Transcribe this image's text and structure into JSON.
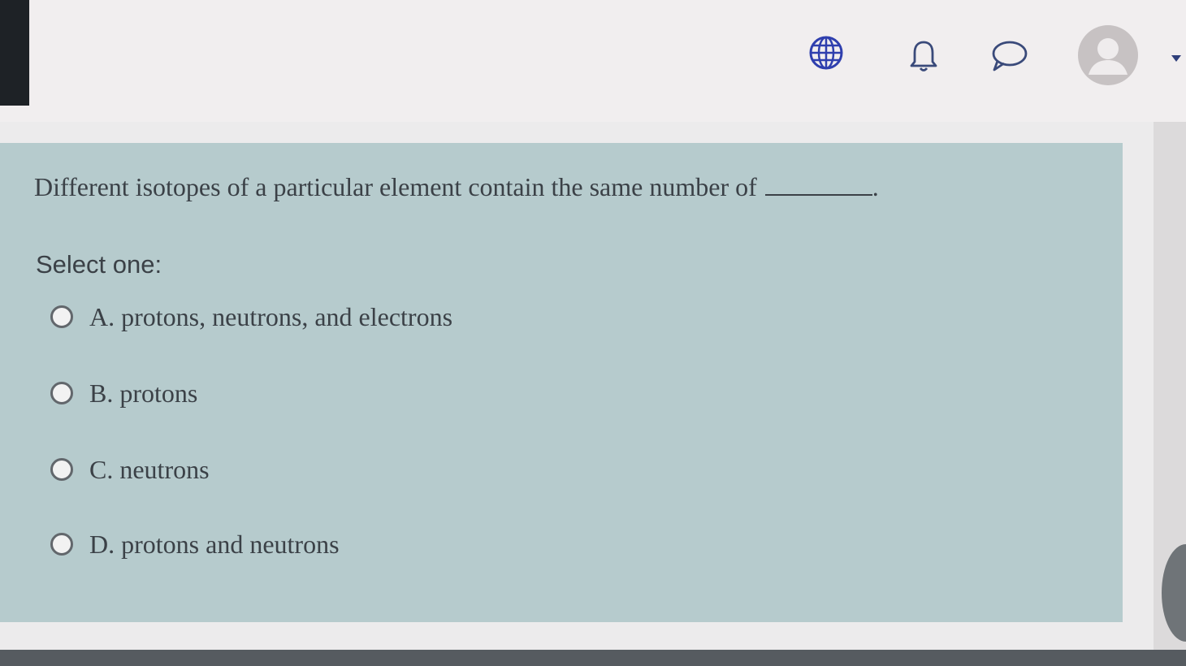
{
  "nav": {
    "icons": [
      "globe-icon",
      "bell-icon",
      "chat-icon",
      "user-avatar-icon",
      "caret-down-icon"
    ]
  },
  "question": {
    "text": "Different isotopes of a particular element contain the same number of",
    "suffix": ".",
    "select_label": "Select one:",
    "options": [
      {
        "label": "A. protons, neutrons, and electrons"
      },
      {
        "label": "B. protons"
      },
      {
        "label": "C. neutrons"
      },
      {
        "label": "D. protons and neutrons"
      }
    ]
  },
  "colors": {
    "card_background": "#b6cbcd",
    "text": "#3b4147",
    "navbar": "#f1eeef"
  }
}
